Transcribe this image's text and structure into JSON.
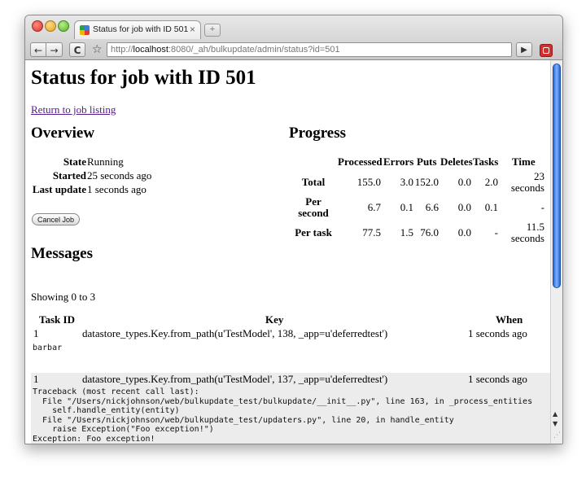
{
  "browser": {
    "tab_title": "Status for job with ID 501",
    "tab_close": "×",
    "newtab_glyph": "+",
    "back_glyph": "←",
    "forward_glyph": "→",
    "reload_glyph": "C",
    "star_glyph": "☆",
    "url_prefix": "http://",
    "url_host": "localhost",
    "url_rest": ":8080/_ah/bulkupdate/admin/status?id=501",
    "go_glyph": "▶"
  },
  "page": {
    "title": "Status for job with ID 501",
    "back_link": "Return to job listing"
  },
  "overview": {
    "heading": "Overview",
    "rows": [
      {
        "label": "State",
        "value": "Running"
      },
      {
        "label": "Started",
        "value": "25 seconds ago"
      },
      {
        "label": "Last update",
        "value": "1 seconds ago"
      }
    ],
    "cancel_label": "Cancel Job"
  },
  "progress": {
    "heading": "Progress",
    "columns": [
      "Processed",
      "Errors",
      "Puts",
      "Deletes",
      "Tasks",
      "Time"
    ],
    "rows": [
      {
        "label": [
          "Total"
        ],
        "values": [
          "155.0",
          "3.0",
          "152.0",
          "0.0",
          "2.0"
        ],
        "time": [
          "23",
          "seconds"
        ]
      },
      {
        "label": [
          "Per",
          "second"
        ],
        "values": [
          "6.7",
          "0.1",
          "6.6",
          "0.0",
          "0.1"
        ],
        "time": [
          "-"
        ]
      },
      {
        "label": [
          "Per task"
        ],
        "values": [
          "77.5",
          "1.5",
          "76.0",
          "0.0",
          "-"
        ],
        "time": [
          "11.5",
          "seconds"
        ]
      }
    ]
  },
  "messages": {
    "heading": "Messages",
    "showing": "Showing 0 to 3",
    "columns": [
      "Task ID",
      "Key",
      "When"
    ],
    "rows": [
      {
        "task_id": "1",
        "key": "datastore_types.Key.from_path(u'TestModel', 138, _app=u'deferredtest')",
        "when": "1 seconds ago",
        "detail": "barbar"
      },
      {
        "task_id": "1",
        "key": "datastore_types.Key.from_path(u'TestModel', 137, _app=u'deferredtest')",
        "when": "1 seconds ago",
        "detail": "Traceback (most recent call last):\n  File \"/Users/nickjohnson/web/bulkupdate_test/bulkupdate/__init__.py\", line 163, in _process_entities\n    self.handle_entity(entity)\n  File \"/Users/nickjohnson/web/bulkupdate_test/updaters.py\", line 20, in handle_entity\n    raise Exception(\"Foo exception!\")\nException: Foo exception!"
      }
    ]
  },
  "scrollbar": {
    "up_glyph": "▲",
    "down_glyph": "▼",
    "grip_glyph": "⋰"
  }
}
